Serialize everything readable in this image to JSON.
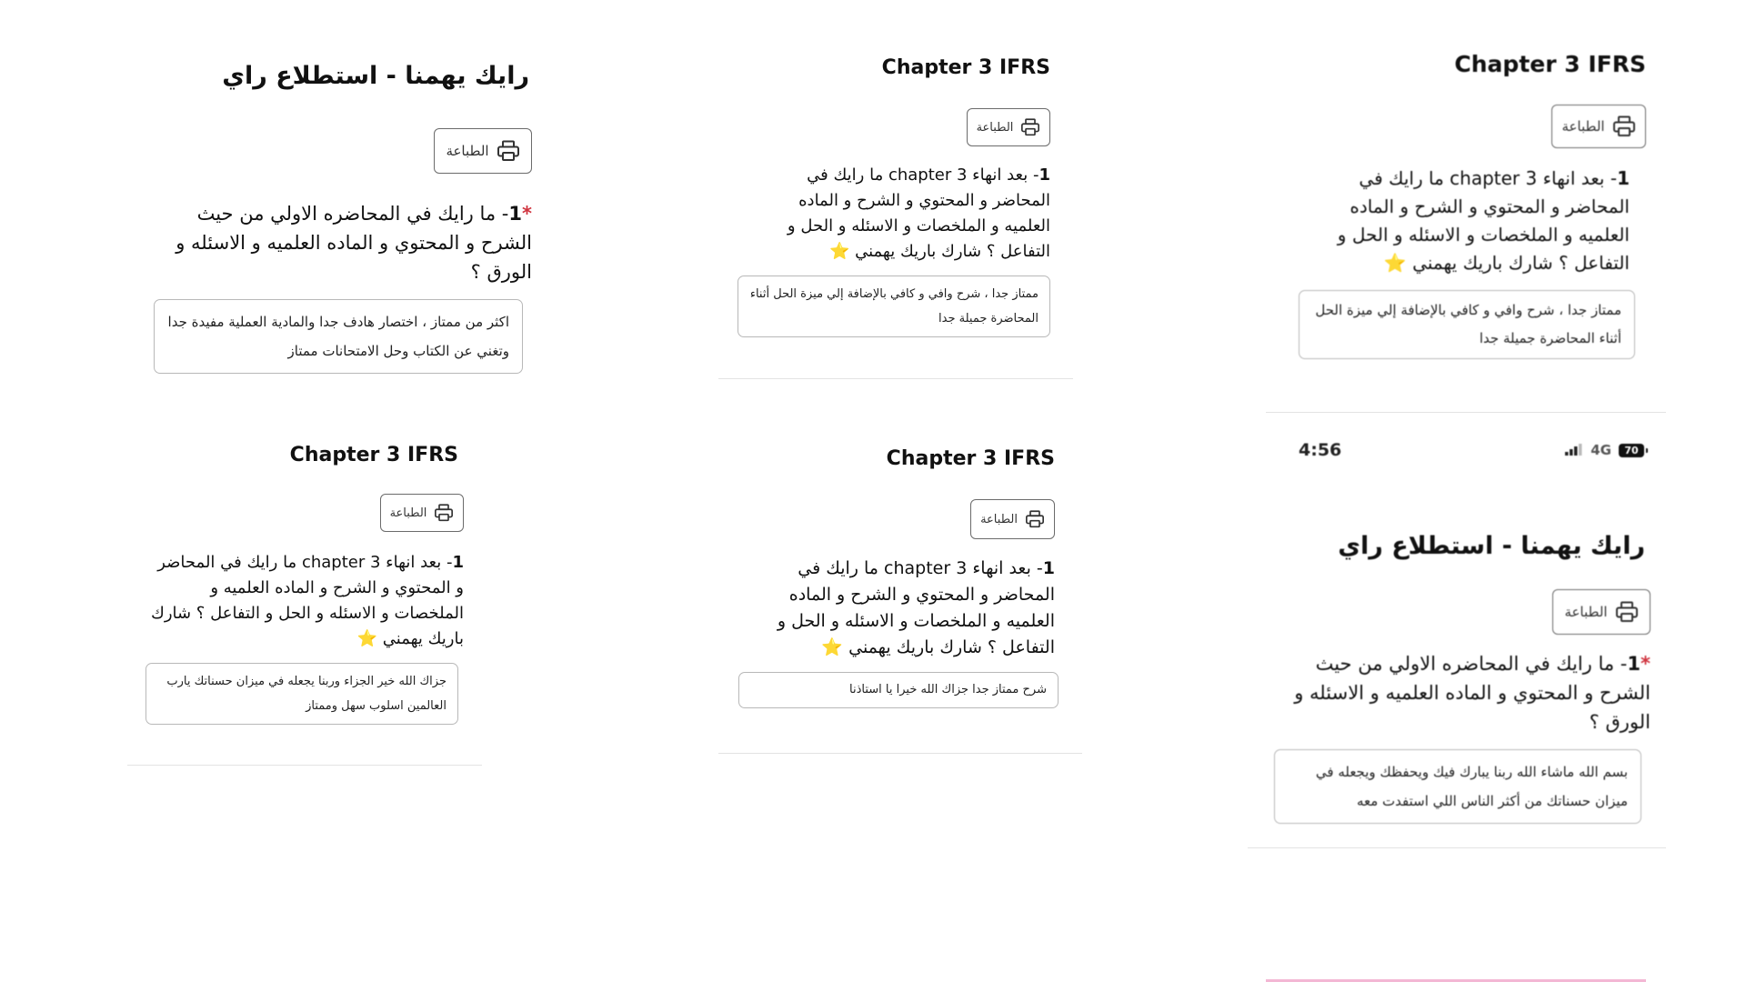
{
  "card1": {
    "title": "رايك يهمنا - استطلاع راي",
    "print_label": "الطباعة",
    "q_num": "1",
    "q_text": "- ما رايك في المحاضره الاولي من حيث الشرح و المحتوي و الماده العلميه و الاسئله و الورق ؟",
    "required_mark": "*",
    "answer": "اكثر من ممتاز ، اختصار هادف جدا والمادية العملية مفيدة جدا وتغني عن الكتاب وحل الامتحانات ممتاز"
  },
  "card2": {
    "title": "Chapter 3 IFRS",
    "print_label": "الطباعة",
    "q_num": "1",
    "q_text": "- بعد انهاء chapter 3 ما رايك في المحاضر و المحتوي و الشرح و الماده العلميه و الملخصات و الاسئله و الحل و التفاعل ؟ شارك باريك يهمني ⭐",
    "answer": "ممتاز جدا ، شرح وافي و كافي بالإضافة إلي ميزة الحل أثناء المحاضرة جميلة جدا"
  },
  "card3": {
    "title": "Chapter 3 IFRS",
    "print_label": "الطباعة",
    "q_num": "1",
    "q_text": "- بعد انهاء chapter 3 ما رايك في المحاضر و المحتوي و الشرح و الماده العلميه و الملخصات و الاسئله و الحل و التفاعل ؟ شارك باريك يهمني ⭐",
    "answer": "ممتاز جدا ، شرح وافي و كافي بالإضافة إلي ميزة الحل أثناء المحاضرة جميلة جدا"
  },
  "card4": {
    "title": "Chapter 3 IFRS",
    "print_label": "الطباعة",
    "q_num": "1",
    "q_text": "- بعد انهاء chapter 3 ما رايك في المحاضر و المحتوي و الشرح و الماده العلميه و الملخصات و الاسئله و الحل و التفاعل ؟ شارك باريك يهمني ⭐",
    "answer": "جزاك الله خير الجزاء وربنا يجعله في ميزان حسناتك يارب العالمين اسلوب سهل وممتاز"
  },
  "card5": {
    "title": "Chapter 3 IFRS",
    "print_label": "الطباعة",
    "q_num": "1",
    "q_text": "- بعد انهاء chapter 3 ما رايك في المحاضر و المحتوي و الشرح و الماده العلميه و الملخصات و الاسئله و الحل و التفاعل ؟ شارك باريك يهمني ⭐",
    "answer": "شرح ممتاز جدا جزاك الله خيرا يا استاذنا"
  },
  "card6": {
    "status_time": "4:56",
    "status_network": "4G",
    "status_battery": "70",
    "title": "رايك يهمنا - استطلاع راي",
    "print_label": "الطباعة",
    "q_num": "1",
    "q_text": "- ما رايك في المحاضره الاولي من حيث الشرح و المحتوي و الماده العلميه و الاسئله و الورق ؟",
    "required_mark": "*",
    "answer": "بسم الله ماشاء الله ربنا يبارك فيك ويحفظك ويجعله في ميزان حسناتك من أكثر الناس اللي استفدت معه"
  },
  "colors": {
    "required": "#d0343f",
    "border": "#b8b8b8",
    "separator": "#e3e3e3",
    "accent_strip": "#f3b7d4"
  },
  "icons": {
    "print": "printer-icon",
    "signal": "signal-bars-icon",
    "battery": "battery-icon"
  }
}
